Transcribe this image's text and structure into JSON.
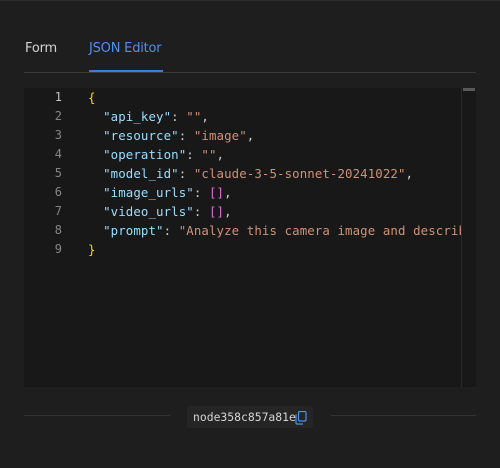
{
  "tabs": {
    "form_label": "Form",
    "json_label": "JSON Editor",
    "active": "JSON Editor"
  },
  "editor": {
    "active_line": 1,
    "line_numbers": [
      "1",
      "2",
      "3",
      "4",
      "5",
      "6",
      "7",
      "8",
      "9"
    ],
    "lines": [
      [
        {
          "t": "{",
          "c": "b1"
        }
      ],
      [
        {
          "t": "  ",
          "c": "p"
        },
        {
          "t": "\"api_key\"",
          "c": "k"
        },
        {
          "t": ": ",
          "c": "p"
        },
        {
          "t": "\"\"",
          "c": "s"
        },
        {
          "t": ",",
          "c": "p"
        }
      ],
      [
        {
          "t": "  ",
          "c": "p"
        },
        {
          "t": "\"resource\"",
          "c": "k"
        },
        {
          "t": ": ",
          "c": "p"
        },
        {
          "t": "\"image\"",
          "c": "s"
        },
        {
          "t": ",",
          "c": "p"
        }
      ],
      [
        {
          "t": "  ",
          "c": "p"
        },
        {
          "t": "\"operation\"",
          "c": "k"
        },
        {
          "t": ": ",
          "c": "p"
        },
        {
          "t": "\"\"",
          "c": "s"
        },
        {
          "t": ",",
          "c": "p"
        }
      ],
      [
        {
          "t": "  ",
          "c": "p"
        },
        {
          "t": "\"model_id\"",
          "c": "k"
        },
        {
          "t": ": ",
          "c": "p"
        },
        {
          "t": "\"claude-3-5-sonnet-20241022\"",
          "c": "s"
        },
        {
          "t": ",",
          "c": "p"
        }
      ],
      [
        {
          "t": "  ",
          "c": "p"
        },
        {
          "t": "\"image_urls\"",
          "c": "k"
        },
        {
          "t": ": ",
          "c": "p"
        },
        {
          "t": "[]",
          "c": "b2"
        },
        {
          "t": ",",
          "c": "p"
        }
      ],
      [
        {
          "t": "  ",
          "c": "p"
        },
        {
          "t": "\"video_urls\"",
          "c": "k"
        },
        {
          "t": ": ",
          "c": "p"
        },
        {
          "t": "[]",
          "c": "b2"
        },
        {
          "t": ",",
          "c": "p"
        }
      ],
      [
        {
          "t": "  ",
          "c": "p"
        },
        {
          "t": "\"prompt\"",
          "c": "k"
        },
        {
          "t": ": ",
          "c": "p"
        },
        {
          "t": "\"Analyze this camera image and describ",
          "c": "s"
        }
      ],
      [
        {
          "t": "}",
          "c": "b1"
        }
      ]
    ]
  },
  "footer": {
    "node_id": "node358c857a81e",
    "copy_icon": "copy-icon"
  },
  "colors": {
    "background": "#1e1e1e",
    "editor_background": "#181818",
    "accent": "#3d7be0",
    "json_key": "#9cdcfe",
    "json_string": "#ce9178",
    "bracket_outer": "#ffd700",
    "bracket_array": "#da70d6"
  }
}
